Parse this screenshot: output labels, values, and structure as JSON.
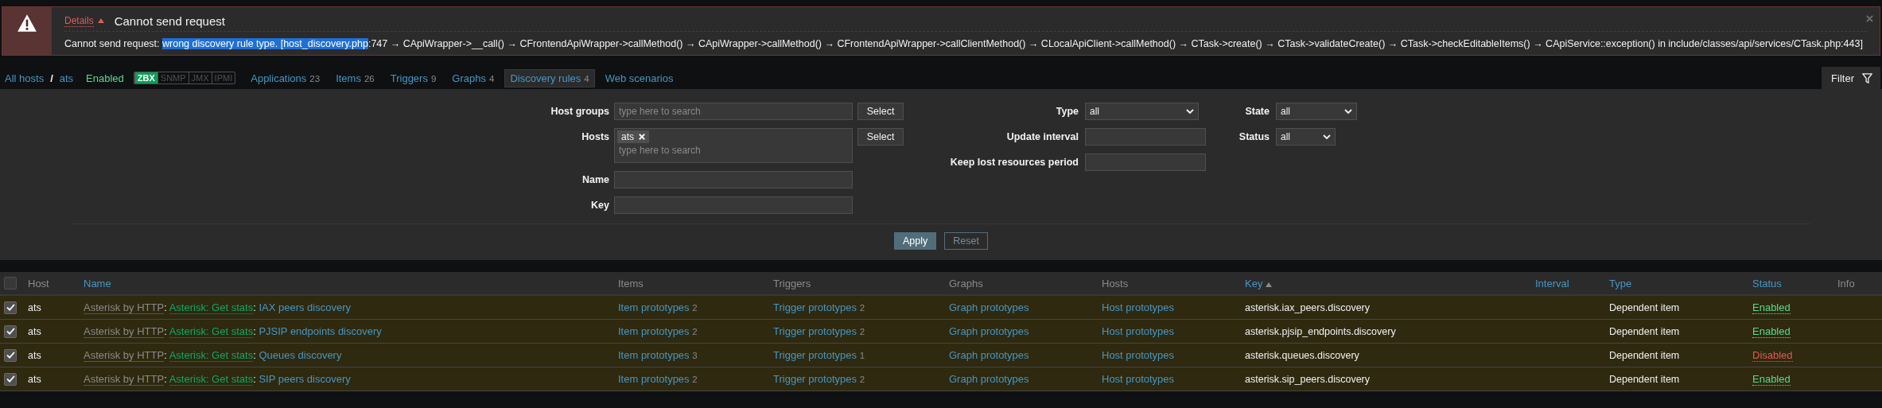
{
  "error": {
    "details_label": "Details",
    "title": "Cannot send request",
    "message_parts": [
      {
        "text": "Cannot send request: ",
        "selected": false
      },
      {
        "text": "wrong discovery rule type. [host_discovery.php",
        "selected": true
      },
      {
        "text": ":747 → CApiWrapper->__call() → CFrontendApiWrapper->callMethod() → CApiWrapper->callMethod() → CFrontendApiWrapper->callClientMethod() → CLocalApiClient->callMethod() → CTask->create() → CTask->validateCreate() → CTask->checkEditableItems() → CApiService::exception() in include/classes/api/services/CTask.php:443]",
        "selected": false
      }
    ]
  },
  "nav": {
    "breadcrumbs": [
      "All hosts",
      "ats"
    ],
    "separator": "/",
    "host_status": "Enabled",
    "availability": [
      {
        "label": "ZBX",
        "on": true
      },
      {
        "label": "SNMP",
        "on": false
      },
      {
        "label": "JMX",
        "on": false
      },
      {
        "label": "IPMI",
        "on": false
      }
    ],
    "tabs": [
      {
        "label": "Applications",
        "count": "23",
        "selected": false
      },
      {
        "label": "Items",
        "count": "26",
        "selected": false
      },
      {
        "label": "Triggers",
        "count": "9",
        "selected": false
      },
      {
        "label": "Graphs",
        "count": "4",
        "selected": false
      },
      {
        "label": "Discovery rules",
        "count": "4",
        "selected": true
      },
      {
        "label": "Web scenarios",
        "selected": false
      }
    ],
    "filter_tab": "Filter"
  },
  "filter": {
    "host_groups": {
      "label": "Host groups",
      "placeholder": "type here to search",
      "button": "Select"
    },
    "hosts": {
      "label": "Hosts",
      "tags": [
        "ats"
      ],
      "placeholder": "type here to search",
      "button": "Select"
    },
    "name": {
      "label": "Name"
    },
    "key": {
      "label": "Key"
    },
    "type": {
      "label": "Type",
      "value": "all"
    },
    "update_interval": {
      "label": "Update interval"
    },
    "keep_lost": {
      "label": "Keep lost resources period"
    },
    "state": {
      "label": "State",
      "value": "all"
    },
    "status": {
      "label": "Status",
      "value": "all"
    },
    "apply": "Apply",
    "reset": "Reset"
  },
  "table": {
    "select_all": false,
    "columns": [
      {
        "label": "Host",
        "sortable": false
      },
      {
        "label": "Name",
        "sortable": true
      },
      {
        "label": "Items",
        "sortable": false
      },
      {
        "label": "Triggers",
        "sortable": false
      },
      {
        "label": "Graphs",
        "sortable": false
      },
      {
        "label": "Hosts",
        "sortable": false
      },
      {
        "label": "Key",
        "sortable": true,
        "sorted_ascending": true
      },
      {
        "label": "Interval",
        "sortable": true
      },
      {
        "label": "Type",
        "sortable": true
      },
      {
        "label": "Status",
        "sortable": true
      },
      {
        "label": "Info",
        "sortable": false
      }
    ],
    "rows": [
      {
        "selected": true,
        "host": "ats",
        "template": "Asterisk by HTTP",
        "separators": [
          ":",
          ":"
        ],
        "parent": "Asterisk: Get stats",
        "name": "IAX peers discovery",
        "items": "Item prototypes",
        "items_count": "2",
        "triggers": "Trigger prototypes",
        "triggers_count": "2",
        "graphs": "Graph prototypes",
        "hosts": "Host prototypes",
        "key": "asterisk.iax_peers.discovery",
        "type": "Dependent item",
        "status": "Enabled",
        "enabled": true
      },
      {
        "selected": true,
        "host": "ats",
        "template": "Asterisk by HTTP",
        "separators": [
          ":",
          ":"
        ],
        "parent": "Asterisk: Get stats",
        "name": "PJSIP endpoints discovery",
        "items": "Item prototypes",
        "items_count": "2",
        "triggers": "Trigger prototypes",
        "triggers_count": "2",
        "graphs": "Graph prototypes",
        "hosts": "Host prototypes",
        "key": "asterisk.pjsip_endpoints.discovery",
        "type": "Dependent item",
        "status": "Enabled",
        "enabled": true
      },
      {
        "selected": true,
        "host": "ats",
        "template": "Asterisk by HTTP",
        "separators": [
          ":",
          ":"
        ],
        "parent": "Asterisk: Get stats",
        "name": "Queues discovery",
        "items": "Item prototypes",
        "items_count": "3",
        "triggers": "Trigger prototypes",
        "triggers_count": "1",
        "graphs": "Graph prototypes",
        "hosts": "Host prototypes",
        "key": "asterisk.queues.discovery",
        "type": "Dependent item",
        "status": "Disabled",
        "enabled": false
      },
      {
        "selected": true,
        "host": "ats",
        "template": "Asterisk by HTTP",
        "separators": [
          ":",
          ":"
        ],
        "parent": "Asterisk: Get stats",
        "name": "SIP peers discovery",
        "items": "Item prototypes",
        "items_count": "2",
        "triggers": "Trigger prototypes",
        "triggers_count": "2",
        "graphs": "Graph prototypes",
        "hosts": "Host prototypes",
        "key": "asterisk.sip_peers.discovery",
        "type": "Dependent item",
        "status": "Enabled",
        "enabled": true
      }
    ]
  }
}
